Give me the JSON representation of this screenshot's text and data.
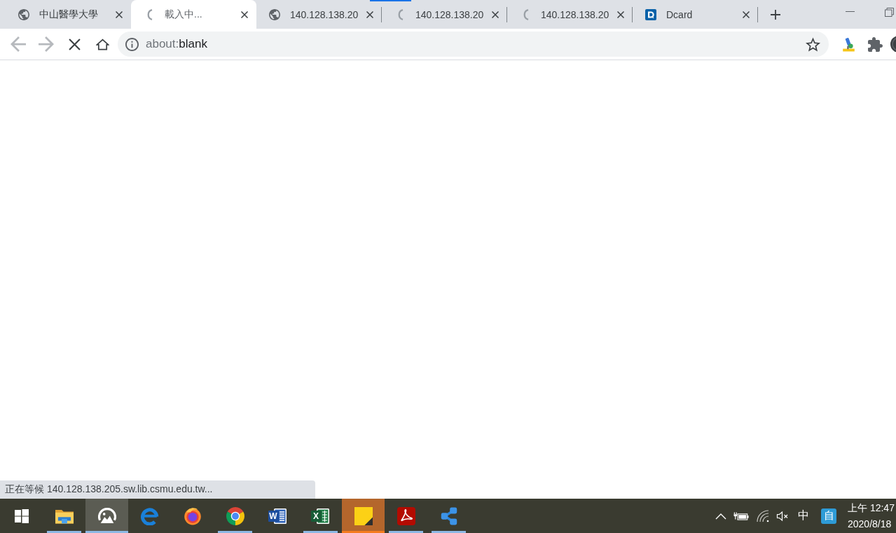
{
  "tabs": [
    {
      "title": "中山醫學大學",
      "kind": "web",
      "selected": false
    },
    {
      "title": "載入中...",
      "kind": "loading",
      "selected": true
    },
    {
      "title": "140.128.138.20",
      "kind": "web",
      "selected": false
    },
    {
      "title": "140.128.138.20",
      "kind": "loading",
      "selected": false
    },
    {
      "title": "140.128.138.20",
      "kind": "loading",
      "selected": false
    },
    {
      "title": "Dcard",
      "kind": "logo",
      "selected": false
    }
  ],
  "toolbar": {
    "back": {
      "disabled": true
    },
    "forward": {
      "disabled": true
    }
  },
  "address_bar": {
    "scheme": "about:",
    "path": "blank"
  },
  "status_bubble": {
    "text": "正在等候 140.128.138.205.sw.lib.csmu.edu.tw..."
  },
  "taskbar": {
    "apps": [
      {
        "kind": "folder",
        "running": true,
        "active": false,
        "flashing": false
      },
      {
        "kind": "mountains",
        "running": true,
        "active": true,
        "flashing": false
      },
      {
        "kind": "ering",
        "running": false,
        "active": false,
        "flashing": false
      },
      {
        "kind": "foxglobe",
        "running": false,
        "active": false,
        "flashing": false
      },
      {
        "kind": "tricircle",
        "running": true,
        "active": false,
        "flashing": false
      },
      {
        "kind": "document",
        "letter": "W",
        "running": false,
        "active": false,
        "flashing": false
      },
      {
        "kind": "spreadsheet",
        "letter": "X",
        "running": true,
        "active": false,
        "flashing": false
      },
      {
        "kind": "note",
        "running": true,
        "active": false,
        "flashing": true
      },
      {
        "kind": "pdf",
        "running": true,
        "active": false,
        "flashing": false
      },
      {
        "kind": "nodes",
        "running": true,
        "active": false,
        "flashing": false
      }
    ],
    "ime_mode": "中",
    "ime_tile": "自",
    "clock": {
      "time": "上午 12:47",
      "date": "2020/8/18"
    }
  }
}
